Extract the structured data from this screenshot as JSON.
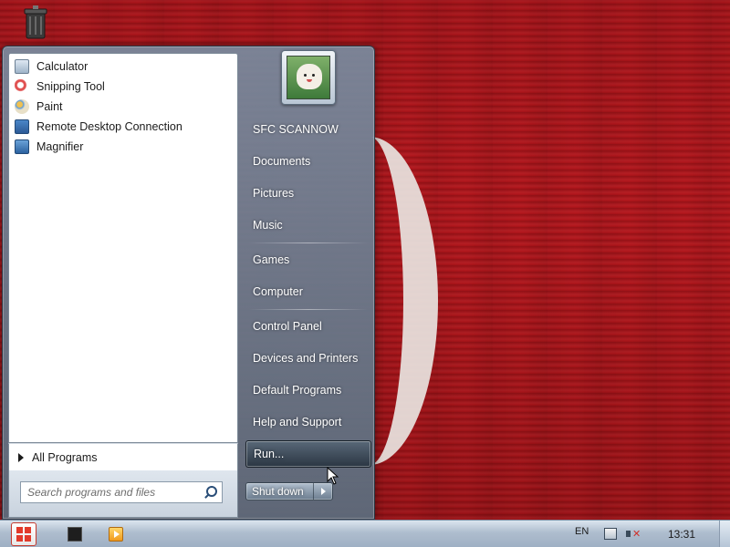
{
  "start_menu": {
    "pinned_programs": [
      {
        "label": "Calculator",
        "icon": "calculator-icon"
      },
      {
        "label": "Snipping Tool",
        "icon": "snipping-tool-icon"
      },
      {
        "label": "Paint",
        "icon": "paint-icon"
      },
      {
        "label": "Remote Desktop Connection",
        "icon": "remote-desktop-icon"
      },
      {
        "label": "Magnifier",
        "icon": "magnifier-icon"
      }
    ],
    "all_programs_label": "All Programs",
    "search_placeholder": "Search programs and files",
    "right_links": [
      {
        "label": "SFC SCANNOW"
      },
      {
        "label": "Documents"
      },
      {
        "label": "Pictures"
      },
      {
        "label": "Music"
      },
      {
        "label": "Games"
      },
      {
        "label": "Computer"
      },
      {
        "label": "Control Panel"
      },
      {
        "label": "Devices and Printers"
      },
      {
        "label": "Default Programs"
      },
      {
        "label": "Help and Support"
      },
      {
        "label": "Run..."
      }
    ],
    "highlighted_link": "Run...",
    "shutdown_label": "Shut down"
  },
  "taskbar": {
    "language": "EN",
    "clock": "13:31"
  },
  "colors": {
    "wallpaper": "#a8141a",
    "menu_glass": "#6c7e90",
    "taskbar": "#aebdce"
  }
}
